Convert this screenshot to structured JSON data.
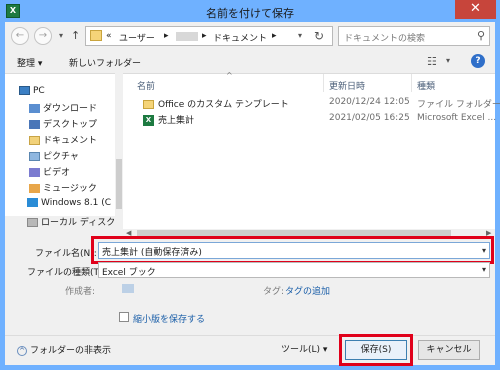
{
  "window": {
    "title": "名前を付けて保存",
    "app_icon": "excel-icon",
    "close_label": "✕"
  },
  "address": {
    "path_prefix": "«",
    "segment_user": "ユーザー",
    "segment_docs": "ドキュメント",
    "separator": "▸",
    "search_placeholder": "ドキュメントの検索"
  },
  "toolbar": {
    "organize": "整理 ▾",
    "new_folder": "新しいフォルダー"
  },
  "navigation": {
    "items": [
      {
        "label": "PC",
        "icon": "pc-icon"
      },
      {
        "label": "ダウンロード",
        "icon": "download-icon"
      },
      {
        "label": "デスクトップ",
        "icon": "desktop-icon"
      },
      {
        "label": "ドキュメント",
        "icon": "documents-icon"
      },
      {
        "label": "ピクチャ",
        "icon": "pictures-icon"
      },
      {
        "label": "ビデオ",
        "icon": "videos-icon"
      },
      {
        "label": "ミュージック",
        "icon": "music-icon"
      },
      {
        "label": "Windows 8.1 (C",
        "icon": "windows-drive-icon"
      },
      {
        "label": "ローカル ディスク (I",
        "icon": "local-disk-icon"
      }
    ]
  },
  "file_list": {
    "headers": [
      "名前",
      "更新日時",
      "種類"
    ],
    "rows": [
      {
        "name": "Office のカスタム テンプレート",
        "date": "2020/12/24 12:05",
        "type": "ファイル フォルダー",
        "icon": "folder-icon"
      },
      {
        "name": "売上集計",
        "date": "2021/02/05 16:25",
        "type": "Microsoft Excel ...",
        "icon": "excel-file-icon"
      }
    ]
  },
  "form": {
    "filename_label": "ファイル名(N):",
    "filename_value": "売上集計 (自動保存済み)",
    "filetype_label": "ファイルの種類(T):",
    "filetype_value": "Excel ブック",
    "author_label": "作成者:",
    "tags_label": "タグ:",
    "tags_link": "タグの追加",
    "thumbnail_label": "縮小版を保存する"
  },
  "footer": {
    "hide_folders": "フォルダーの非表示",
    "tools": "ツール(L)",
    "save": "保存(S)",
    "cancel": "キャンセル"
  },
  "colors": {
    "title_bar": "#6fb1ff",
    "close_button": "#c7453b",
    "highlight": "#e0001a",
    "link": "#1a5ea8"
  }
}
